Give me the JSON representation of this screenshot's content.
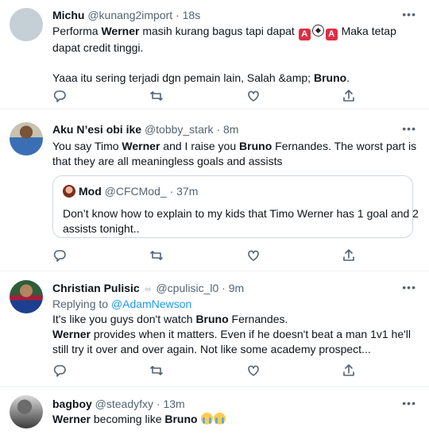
{
  "tweets": [
    {
      "name": "Michu",
      "handle": "@kunang2import",
      "dot": "·",
      "time": "18s",
      "more": "•••",
      "body": {
        "l1_a": "Performa ",
        "l1_b": "Werner",
        "l1_c": " masih kurang bagus tapi dapat ",
        "emoji_a": "A",
        "emoji_c": "A",
        "l1_d": " Maka tetap",
        "l2": "dapat credit tinggi.",
        "l3_a": "Yaaa itu sering terjadi dgn pemain lain, Salah &amp; ",
        "l3_b": "Bruno",
        "l3_c": "."
      },
      "avatar_color": "#c4cfd6"
    },
    {
      "name": "Aku N’esi obi ike",
      "handle": "@tobby_stark",
      "dot": "·",
      "time": "8m",
      "more": "•••",
      "body": {
        "l1_a": "You say Timo ",
        "l1_b": "Werner",
        "l1_c": " and I raise you ",
        "l1_d": "Bruno",
        "l1_e": " Fernandes. The worst part is",
        "l2": "that they are all meaningless goals and assists"
      },
      "quote": {
        "name": "Mod",
        "handle": "@CFCMod_",
        "dot": "·",
        "time": "37m",
        "l1": "Don’t know how to explain to my kids that Timo Werner has 1 goal and 2",
        "l2": "assists tonight.."
      }
    },
    {
      "name": "Christian Pulisic",
      "handle": "@cpulisic_l0",
      "dot": "·",
      "time": "9m",
      "more": "•••",
      "replying": "Replying to",
      "replying_to": "@AdamNewson",
      "body": {
        "l1_a": "It's like you guys don't  watch ",
        "l1_b": "Bruno",
        "l1_c": " Fernandes.",
        "l2_a": "Werner",
        "l2_b": " provides when it matters. Even if he doesn't  beat a man 1v1 he'll",
        "l3": "still try it over and over again.  Not like some academy prospect..."
      }
    },
    {
      "name": "bagboy",
      "handle": "@steadyfxy",
      "dot": "·",
      "time": "13m",
      "more": "•••",
      "body": {
        "l1_a": "Werner",
        "l1_b": " becoming like ",
        "l1_c": "Bruno"
      }
    }
  ],
  "colors": {
    "link": "#1d9bf0",
    "secondary": "#536471",
    "border": "#eff3f4"
  },
  "action_icons": [
    "reply-icon",
    "retweet-icon",
    "like-icon",
    "share-icon"
  ]
}
